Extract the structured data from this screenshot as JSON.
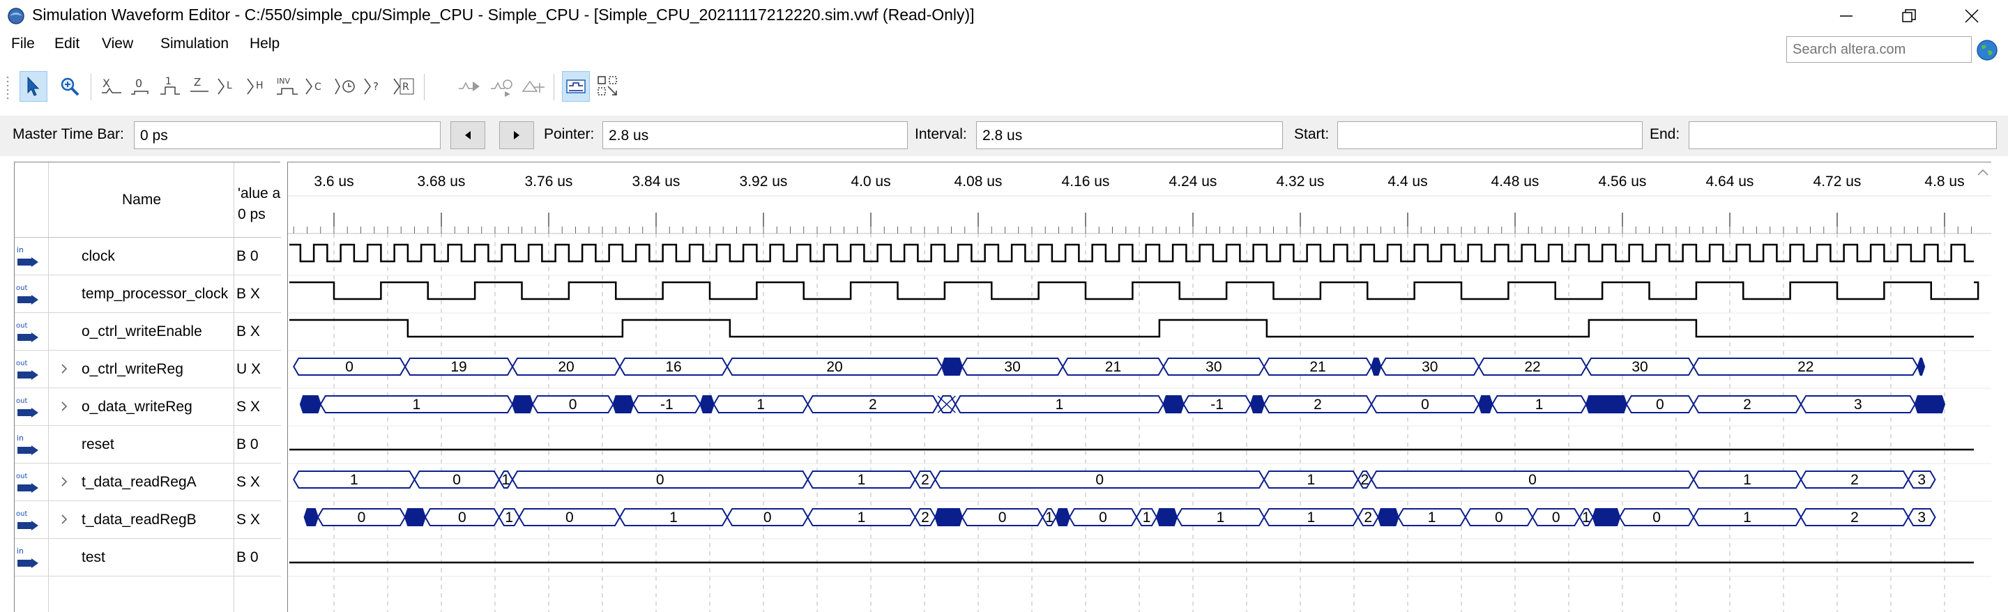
{
  "window": {
    "title": "Simulation Waveform Editor - C:/550/simple_cpu/Simple_CPU - Simple_CPU - [Simple_CPU_20211117212220.sim.vwf (Read-Only)]"
  },
  "menu": [
    "File",
    "Edit",
    "View",
    "Simulation",
    "Help"
  ],
  "search": {
    "placeholder": "Search altera.com"
  },
  "toolbar": {
    "buttons": [
      "selection-tool",
      "zoom-tool",
      "forcing-unknown",
      "forcing-low",
      "forcing-high",
      "high-impedance",
      "weak-low",
      "weak-high",
      "invert",
      "count-value",
      "overwrite-clock",
      "arbitrary-value",
      "random-value",
      "run-functional-simulation",
      "run-timing-simulation",
      "generate-netlist",
      "waveform-settings",
      "snap-to-grid"
    ],
    "active": [
      "selection-tool",
      "waveform-settings"
    ]
  },
  "timebar": {
    "master_label": "Master Time Bar:",
    "master_value": "0 ps",
    "pointer_label": "Pointer:",
    "pointer_value": "2.8 us",
    "interval_label": "Interval:",
    "interval_value": "2.8 us",
    "start_label": "Start:",
    "start_value": "",
    "end_label": "End:",
    "end_value": ""
  },
  "signal_table": {
    "name_header": "Name",
    "value_header": "'alue a\n0 ps"
  },
  "signals": [
    {
      "dir": "in",
      "name": "clock",
      "value": "B 0",
      "expandable": false
    },
    {
      "dir": "out",
      "name": "temp_processor_clock",
      "value": "B X",
      "expandable": false
    },
    {
      "dir": "out",
      "name": "o_ctrl_writeEnable",
      "value": "B X",
      "expandable": false
    },
    {
      "dir": "out",
      "name": "o_ctrl_writeReg",
      "value": "U X",
      "expandable": true
    },
    {
      "dir": "out",
      "name": "o_data_writeReg",
      "value": "S X",
      "expandable": true
    },
    {
      "dir": "in",
      "name": "reset",
      "value": "B 0",
      "expandable": false
    },
    {
      "dir": "out",
      "name": "t_data_readRegA",
      "value": "S X",
      "expandable": true
    },
    {
      "dir": "out",
      "name": "t_data_readRegB",
      "value": "S X",
      "expandable": true
    },
    {
      "dir": "in",
      "name": "test",
      "value": "B 0",
      "expandable": false
    }
  ],
  "time_axis": {
    "ticks": [
      "3.6 us",
      "3.68 us",
      "3.76 us",
      "3.84 us",
      "3.92 us",
      "4.0 us",
      "4.08 us",
      "4.16 us",
      "4.24 us",
      "4.32 us",
      "4.4 us",
      "4.48 us",
      "4.56 us",
      "4.64 us",
      "4.72 us",
      "4.8 us"
    ]
  },
  "waveforms": {
    "clock_period_ns": 20,
    "temp_processor_clock_edges_us": [
      3.565,
      3.6,
      3.635,
      3.67,
      3.705,
      3.74,
      3.775,
      3.81,
      3.845,
      3.88,
      3.915,
      3.95,
      3.985,
      4.02,
      4.055,
      4.09,
      4.125,
      4.16,
      4.195,
      4.23,
      4.265,
      4.3,
      4.335,
      4.37,
      4.405,
      4.44,
      4.475,
      4.51,
      4.545,
      4.58,
      4.615,
      4.65,
      4.685,
      4.72,
      4.755,
      4.79,
      4.825
    ],
    "o_ctrl_writeEnable_edges_us": [
      3.565,
      3.655,
      3.815,
      3.895,
      4.215,
      4.295,
      4.535,
      4.615
    ],
    "o_ctrl_writeReg": [
      [
        "3.565",
        "",
        ""
      ],
      [
        "3.57",
        "0",
        "v"
      ],
      [
        "3.653",
        "19",
        "v"
      ],
      [
        "3.733",
        "20",
        "v"
      ],
      [
        "3.813",
        "16",
        "v"
      ],
      [
        "3.893",
        "20",
        "v"
      ],
      [
        "4.053",
        "",
        "b"
      ],
      [
        "4.068",
        "30",
        "v"
      ],
      [
        "4.143",
        "21",
        "v"
      ],
      [
        "4.218",
        "30",
        "v"
      ],
      [
        "4.293",
        "21",
        "v"
      ],
      [
        "4.373",
        "",
        "b"
      ],
      [
        "4.38",
        "30",
        "v"
      ],
      [
        "4.453",
        "22",
        "v"
      ],
      [
        "4.533",
        "30",
        "v"
      ],
      [
        "4.613",
        "22",
        "v"
      ],
      [
        "4.78",
        "",
        "b"
      ],
      [
        "4.785",
        "",
        ""
      ]
    ],
    "o_data_writeReg": [
      [
        "3.565",
        "",
        ""
      ],
      [
        "3.575",
        "",
        "b"
      ],
      [
        "3.59",
        "1",
        "v"
      ],
      [
        "3.733",
        "",
        "b"
      ],
      [
        "3.748",
        "0",
        "v"
      ],
      [
        "3.808",
        "",
        "b"
      ],
      [
        "3.823",
        "-1",
        "v"
      ],
      [
        "3.873",
        "",
        "b"
      ],
      [
        "3.883",
        "1",
        "v"
      ],
      [
        "3.953",
        "2",
        "v"
      ],
      [
        "4.05",
        "",
        "x"
      ],
      [
        "4.063",
        "1",
        "v"
      ],
      [
        "4.218",
        "",
        "b"
      ],
      [
        "4.233",
        "-1",
        "v"
      ],
      [
        "4.283",
        "",
        "b"
      ],
      [
        "4.293",
        "2",
        "v"
      ],
      [
        "4.373",
        "0",
        "v"
      ],
      [
        "4.453",
        "",
        "b"
      ],
      [
        "4.463",
        "1",
        "v"
      ],
      [
        "4.533",
        "",
        "b"
      ],
      [
        "4.563",
        "0",
        "v"
      ],
      [
        "4.613",
        "2",
        "v"
      ],
      [
        "4.693",
        "3",
        "v"
      ],
      [
        "4.778",
        "",
        "b"
      ],
      [
        "4.8",
        "",
        ""
      ]
    ],
    "t_data_readRegA": [
      [
        "3.565",
        "",
        ""
      ],
      [
        "3.57",
        "1",
        "v"
      ],
      [
        "3.66",
        "0",
        "v"
      ],
      [
        "3.723",
        "1",
        "v"
      ],
      [
        "3.733",
        "0",
        "v"
      ],
      [
        "3.953",
        "1",
        "v"
      ],
      [
        "4.033",
        "2",
        "v"
      ],
      [
        "4.048",
        "0",
        "v"
      ],
      [
        "4.293",
        "1",
        "v"
      ],
      [
        "4.363",
        "2",
        "v"
      ],
      [
        "4.373",
        "0",
        "v"
      ],
      [
        "4.613",
        "1",
        "v"
      ],
      [
        "4.693",
        "2",
        "v"
      ],
      [
        "4.773",
        "3",
        "v"
      ],
      [
        "4.793",
        "",
        ""
      ]
    ],
    "t_data_readRegB": [
      [
        "3.565",
        "",
        ""
      ],
      [
        "3.578",
        "",
        "b"
      ],
      [
        "3.588",
        "0",
        "v"
      ],
      [
        "3.653",
        "",
        "b"
      ],
      [
        "3.668",
        "0",
        "v"
      ],
      [
        "3.723",
        "1",
        "v"
      ],
      [
        "3.738",
        "0",
        "v"
      ],
      [
        "3.813",
        "1",
        "v"
      ],
      [
        "3.893",
        "0",
        "v"
      ],
      [
        "3.953",
        "1",
        "v"
      ],
      [
        "4.033",
        "2",
        "v"
      ],
      [
        "4.048",
        "",
        "b"
      ],
      [
        "4.068",
        "0",
        "v"
      ],
      [
        "4.128",
        "1",
        "v"
      ],
      [
        "4.138",
        "",
        "b"
      ],
      [
        "4.148",
        "0",
        "v"
      ],
      [
        "4.198",
        "1",
        "v"
      ],
      [
        "4.213",
        "",
        "b"
      ],
      [
        "4.228",
        "1",
        "v"
      ],
      [
        "4.293",
        "1",
        "v"
      ],
      [
        "4.363",
        "2",
        "v"
      ],
      [
        "4.378",
        "",
        "b"
      ],
      [
        "4.393",
        "1",
        "v"
      ],
      [
        "4.443",
        "0",
        "v"
      ],
      [
        "4.493",
        "0",
        "v"
      ],
      [
        "4.528",
        "1",
        "v"
      ],
      [
        "4.538",
        "",
        "b"
      ],
      [
        "4.558",
        "0",
        "v"
      ],
      [
        "4.613",
        "1",
        "v"
      ],
      [
        "4.693",
        "2",
        "v"
      ],
      [
        "4.773",
        "3",
        "v"
      ],
      [
        "4.793",
        "",
        ""
      ]
    ]
  },
  "colors": {
    "bus": "#0b1f8c",
    "wave": "#000000",
    "grid": "#b8b8b8",
    "active_button": "#cce4f7"
  }
}
